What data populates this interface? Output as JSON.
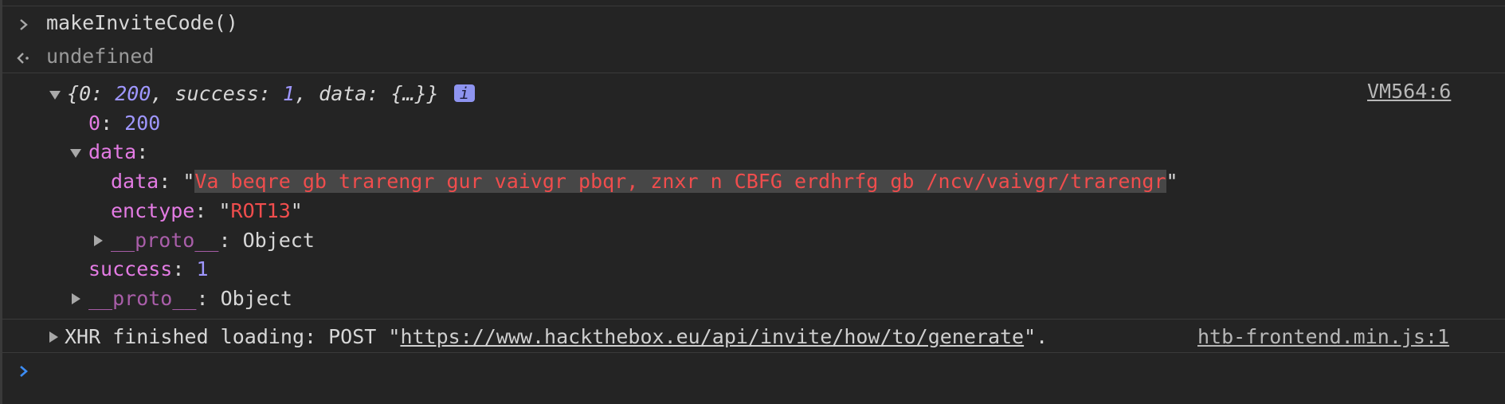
{
  "console": {
    "input_command": "makeInviteCode()",
    "return_value": "undefined",
    "object_preview": {
      "open": "{",
      "k0": "0",
      "v0": "200",
      "k_success": "success",
      "v_success": "1",
      "k_data": "data",
      "v_data": "{…}",
      "close": "}",
      "info_badge": "i",
      "source": "VM564:6"
    },
    "props": {
      "zero_key": "0",
      "zero_value": "200",
      "data_key": "data",
      "inner_data_key": "data",
      "inner_data_value": "Va beqre gb trarengr gur vaivgr pbqr, znxr n CBFG erdhrfg gb /ncv/vaivgr/trarengr",
      "enctype_key": "enctype",
      "enctype_value": "ROT13",
      "proto_key": "__proto__",
      "proto_value": "Object",
      "success_key": "success",
      "success_value": "1",
      "outer_proto_key": "__proto__",
      "outer_proto_value": "Object"
    },
    "xhr": {
      "prefix": "XHR finished loading: POST \"",
      "url": "https://www.hackthebox.eu/api/invite/how/to/generate",
      "suffix": "\".",
      "source": "htb-frontend.min.js:1"
    }
  },
  "colors": {
    "background": "#242424",
    "string": "#f04d4d",
    "key": "#e37be3",
    "number": "#9f97ff",
    "prompt": "#3d8df5"
  },
  "icons": {
    "input_prompt": "chevron-right-icon",
    "result_marker": "return-arrow-icon",
    "expanded": "triangle-down-icon",
    "collapsed": "triangle-right-icon",
    "active_prompt": "blue-chevron-right-icon"
  }
}
